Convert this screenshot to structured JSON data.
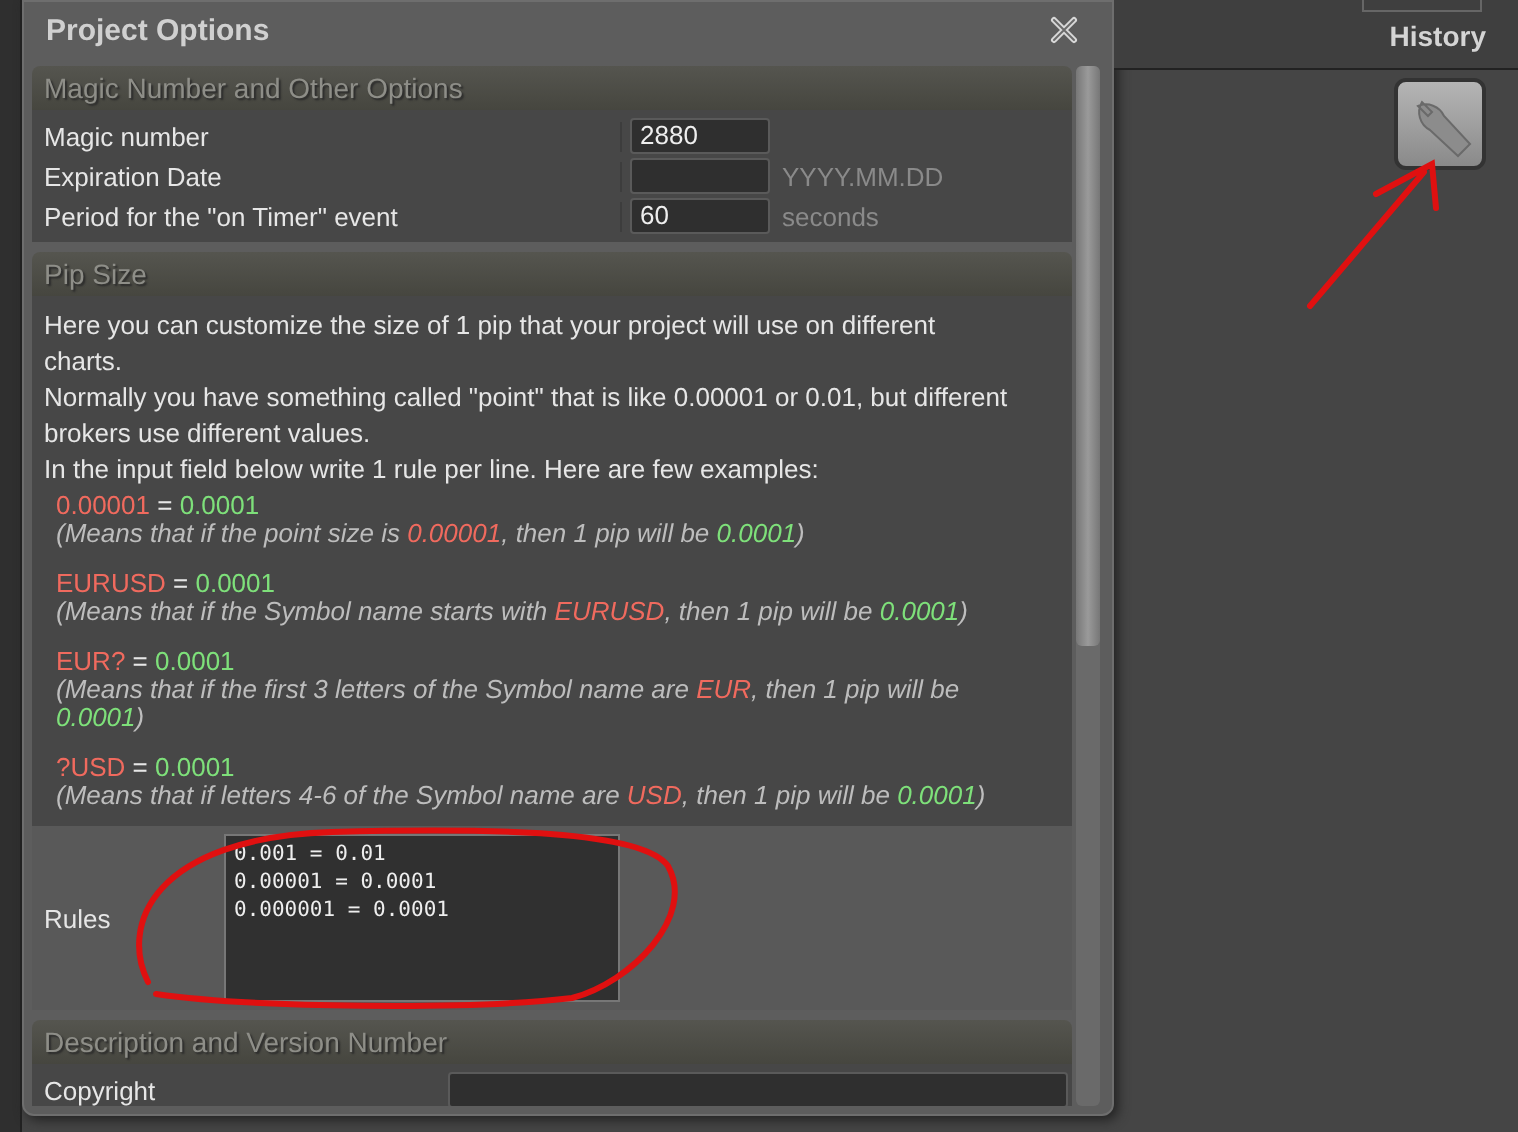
{
  "window": {
    "title": "Project Options"
  },
  "sections": [
    {
      "title": "Magic Number and Other Options",
      "kind": "fields",
      "rows": [
        {
          "label": "Magic number",
          "value": "2880"
        },
        {
          "label": "Expiration Date",
          "suffix": "YYYY.MM.DD"
        },
        {
          "label": "Period for the \"on Timer\" event",
          "value": "60",
          "suffix": "seconds"
        }
      ]
    },
    {
      "title": "Pip Size",
      "kind": "pip",
      "intro": [
        "Here you can customize the size of 1 pip that your project will use on different charts.",
        "Normally you have something called \"point\" that is like 0.00001 or 0.01, but different brokers use different values.",
        "In the input field below write 1 rule per line. Here are few examples:"
      ],
      "examples": [
        {
          "rule": [
            {
              "text": "0.00001",
              "kind": "pattern"
            },
            {
              "text": " = ",
              "kind": "plain"
            },
            {
              "text": "0.0001",
              "kind": "result"
            }
          ],
          "explanation": [
            {
              "text": "(Means that if the point size is ",
              "kind": "plain"
            },
            {
              "text": "0.00001",
              "kind": "pattern"
            },
            {
              "text": ", then 1 pip will be ",
              "kind": "plain"
            },
            {
              "text": "0.0001",
              "kind": "result"
            },
            {
              "text": ")",
              "kind": "plain"
            }
          ]
        },
        {
          "rule": [
            {
              "text": "EURUSD",
              "kind": "pattern"
            },
            {
              "text": " = ",
              "kind": "plain"
            },
            {
              "text": "0.0001",
              "kind": "result"
            }
          ],
          "explanation": [
            {
              "text": "(Means that if the Symbol name starts with ",
              "kind": "plain"
            },
            {
              "text": "EURUSD",
              "kind": "pattern"
            },
            {
              "text": ", then 1 pip will be ",
              "kind": "plain"
            },
            {
              "text": "0.0001",
              "kind": "result"
            },
            {
              "text": ")",
              "kind": "plain"
            }
          ]
        },
        {
          "rule": [
            {
              "text": "EUR?",
              "kind": "pattern"
            },
            {
              "text": " = ",
              "kind": "plain"
            },
            {
              "text": "0.0001",
              "kind": "result"
            }
          ],
          "explanation": [
            {
              "text": "(Means that if the first 3 letters of the Symbol name are ",
              "kind": "plain"
            },
            {
              "text": "EUR",
              "kind": "pattern"
            },
            {
              "text": ", then 1 pip will be ",
              "kind": "plain"
            },
            {
              "text": "0.0001",
              "kind": "result"
            },
            {
              "text": ")",
              "kind": "plain"
            }
          ]
        },
        {
          "rule": [
            {
              "text": "?USD",
              "kind": "pattern"
            },
            {
              "text": " = ",
              "kind": "plain"
            },
            {
              "text": "0.0001",
              "kind": "result"
            }
          ],
          "explanation": [
            {
              "text": "(Means that if letters 4-6 of the Symbol name are ",
              "kind": "plain"
            },
            {
              "text": "USD",
              "kind": "pattern"
            },
            {
              "text": ", then 1 pip will be ",
              "kind": "plain"
            },
            {
              "text": "0.0001",
              "kind": "result"
            },
            {
              "text": ")",
              "kind": "plain"
            }
          ]
        }
      ],
      "rules": {
        "label": "Rules",
        "value": "0.001 = 0.01\n0.00001 = 0.0001\n0.000001 = 0.0001"
      }
    },
    {
      "title": "Description and Version Number",
      "kind": "wide-fields",
      "rows": [
        {
          "label": "Copyright"
        }
      ]
    }
  ],
  "side_panel": {
    "title": "History"
  }
}
